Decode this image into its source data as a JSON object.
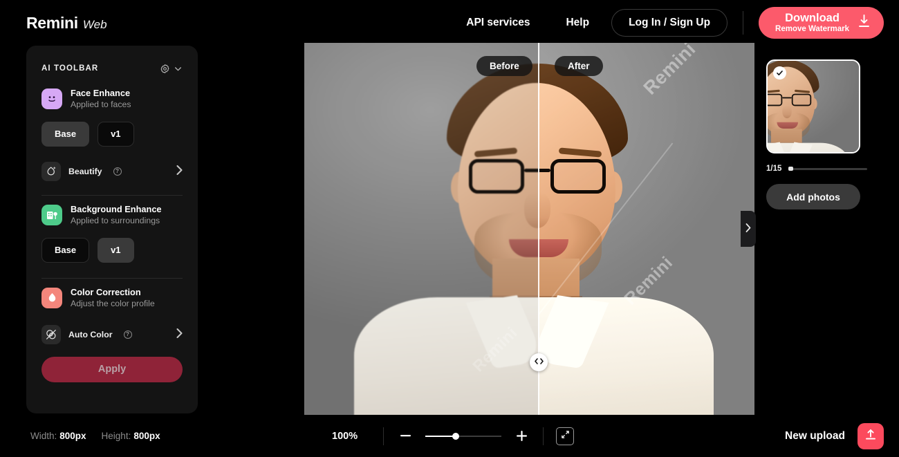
{
  "header": {
    "brand_name": "Remini",
    "brand_sub": "Web",
    "nav": [
      {
        "label": "API services",
        "name": "api-services"
      },
      {
        "label": "Help",
        "name": "help"
      }
    ],
    "login_label": "Log In / Sign Up",
    "download": {
      "main": "Download",
      "sub": "Remove Watermark",
      "icon": "download-icon",
      "color": "#fc5a6b"
    }
  },
  "sidebar": {
    "title": "AI TOOLBAR",
    "gear_icon": "gear-icon",
    "chevron_icon": "chevron-down-icon",
    "features": [
      {
        "name": "face-enhance",
        "title": "Face Enhance",
        "subtitle": "Applied to faces",
        "icon": "smiley-face-icon",
        "icon_color": "#d6a8f5",
        "chips": [
          {
            "label": "Base",
            "selected": true
          },
          {
            "label": "v1",
            "selected": false
          }
        ],
        "sub_option": {
          "label": "Beautify",
          "icon": "beautify-sparkle-icon",
          "info_icon": "info-icon",
          "chevron": "chevron-right-icon"
        }
      },
      {
        "name": "background-enhance",
        "title": "Background Enhance",
        "subtitle": "Applied to surroundings",
        "icon": "building-tree-icon",
        "icon_color": "#4ecb8a",
        "chips": [
          {
            "label": "Base",
            "selected": false
          },
          {
            "label": "v1",
            "selected": true
          }
        ]
      },
      {
        "name": "color-correction",
        "title": "Color Correction",
        "subtitle": "Adjust the color profile",
        "icon": "droplet-icon",
        "icon_color": "#f4867c",
        "sub_option": {
          "label": "Auto Color",
          "icon": "overlapping-circles-icon",
          "info_icon": "info-icon",
          "chevron": "chevron-right-icon"
        }
      }
    ],
    "apply_label": "Apply"
  },
  "canvas": {
    "before_label": "Before",
    "after_label": "After",
    "watermark_text": "Remini",
    "slider_handle_icon": "left-right-chevrons-icon",
    "collapse_icon": "chevron-right-icon"
  },
  "right_panel": {
    "thumbnail_name": "photo-thumbnail",
    "selected_icon": "check-icon",
    "count": "1/15",
    "add_photos_label": "Add photos"
  },
  "bottom": {
    "width_label": "Width:",
    "width_value": "800px",
    "height_label": "Height:",
    "height_value": "800px",
    "zoom_percent": "100%",
    "zoom_out_icon": "minus-icon",
    "zoom_in_icon": "plus-icon",
    "fit_icon": "fit-screen-icon",
    "new_upload_label": "New upload",
    "upload_icon": "upload-icon",
    "upload_color": "#fc4a5d"
  }
}
